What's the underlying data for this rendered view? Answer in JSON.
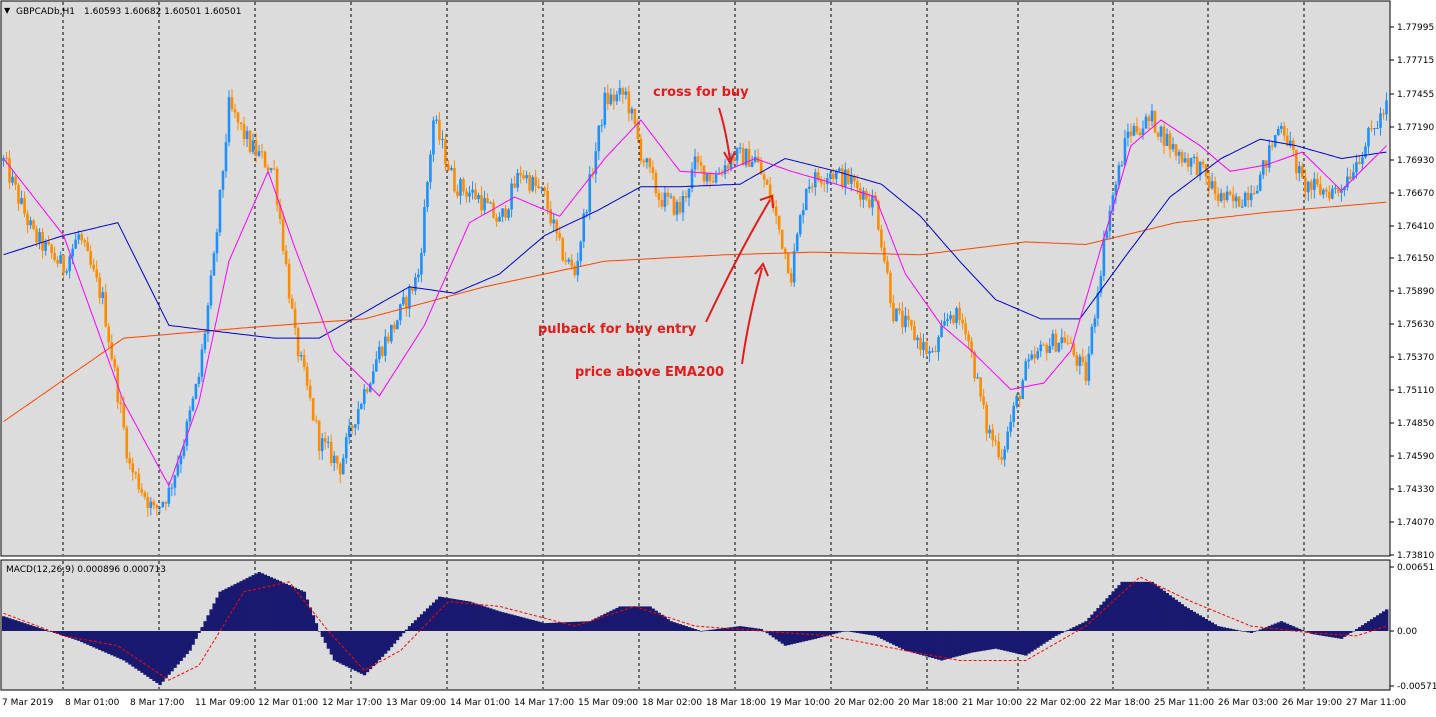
{
  "header": {
    "symbol": "GBPCADb,H1",
    "ohlc": "1.60593 1.60682 1.60501 1.60501",
    "macd_label": "MACD(12,26,9) 0.000896 0.000713"
  },
  "colors": {
    "background": "#dcdcdc",
    "bull_candle": "#1e90ff",
    "bear_candle": "#ff8c00",
    "ema_fast": "#ff00ff",
    "ema_mid": "#0000cd",
    "ema200": "#ff4500",
    "macd_hist": "#191970",
    "macd_signal": "#ff0000",
    "annotation": "#e31b1b"
  },
  "price_axis": [
    "1.77995",
    "1.77715",
    "1.77455",
    "1.77190",
    "1.76930",
    "1.76670",
    "1.76410",
    "1.76150",
    "1.75890",
    "1.75630",
    "1.75370",
    "1.75110",
    "1.74850",
    "1.74590",
    "1.74330",
    "1.74070",
    "1.73810"
  ],
  "macd_axis": [
    "0.00651",
    "0.00",
    "-0.005717"
  ],
  "time_axis": [
    "7 Mar 2019",
    "8 Mar 01:00",
    "8 Mar 17:00",
    "11 Mar 09:00",
    "12 Mar 01:00",
    "12 Mar 17:00",
    "13 Mar 09:00",
    "14 Mar 01:00",
    "14 Mar 17:00",
    "15 Mar 09:00",
    "18 Mar 02:00",
    "18 Mar 18:00",
    "19 Mar 10:00",
    "20 Mar 02:00",
    "20 Mar 18:00",
    "21 Mar 10:00",
    "22 Mar 02:00",
    "22 Mar 18:00",
    "25 Mar 11:00",
    "26 Mar 03:00",
    "26 Mar 19:00",
    "27 Mar 11:00"
  ],
  "annotations": {
    "cross": "cross for buy",
    "pullback": "pulback for buy entry",
    "ema200": "price above EMA200"
  },
  "chart_data": {
    "type": "candlestick",
    "symbol": "GBPCADb",
    "timeframe": "H1",
    "ylim": [
      1.7381,
      1.77995
    ],
    "anchors": [
      [
        0,
        1.7688
      ],
      [
        10,
        1.763
      ],
      [
        20,
        1.7605
      ],
      [
        25,
        1.763
      ],
      [
        33,
        1.758
      ],
      [
        42,
        1.745
      ],
      [
        50,
        1.7415
      ],
      [
        55,
        1.743
      ],
      [
        60,
        1.747
      ],
      [
        65,
        1.752
      ],
      [
        70,
        1.761
      ],
      [
        75,
        1.773
      ],
      [
        82,
        1.77
      ],
      [
        90,
        1.768
      ],
      [
        97,
        1.755
      ],
      [
        105,
        1.747
      ],
      [
        112,
        1.745
      ],
      [
        117,
        1.749
      ],
      [
        125,
        1.754
      ],
      [
        130,
        1.756
      ],
      [
        138,
        1.76
      ],
      [
        143,
        1.772
      ],
      [
        150,
        1.767
      ],
      [
        158,
        1.766
      ],
      [
        165,
        1.764
      ],
      [
        172,
        1.768
      ],
      [
        180,
        1.766
      ],
      [
        185,
        1.762
      ],
      [
        190,
        1.76
      ],
      [
        195,
        1.767
      ],
      [
        200,
        1.7735
      ],
      [
        207,
        1.774
      ],
      [
        212,
        1.7695
      ],
      [
        218,
        1.766
      ],
      [
        225,
        1.765
      ],
      [
        230,
        1.7685
      ],
      [
        236,
        1.7675
      ],
      [
        243,
        1.7692
      ],
      [
        250,
        1.769
      ],
      [
        255,
        1.766
      ],
      [
        262,
        1.76
      ],
      [
        267,
        1.767
      ],
      [
        275,
        1.768
      ],
      [
        282,
        1.7672
      ],
      [
        290,
        1.7655
      ],
      [
        296,
        1.757
      ],
      [
        302,
        1.7555
      ],
      [
        309,
        1.7535
      ],
      [
        315,
        1.757
      ],
      [
        320,
        1.756
      ],
      [
        327,
        1.748
      ],
      [
        332,
        1.746
      ],
      [
        340,
        1.7525
      ],
      [
        347,
        1.7545
      ],
      [
        353,
        1.755
      ],
      [
        360,
        1.752
      ],
      [
        367,
        1.764
      ],
      [
        374,
        1.771
      ],
      [
        382,
        1.772
      ],
      [
        390,
        1.7695
      ],
      [
        397,
        1.7685
      ],
      [
        404,
        1.766
      ],
      [
        410,
        1.7655
      ],
      [
        418,
        1.7675
      ],
      [
        425,
        1.772
      ],
      [
        432,
        1.767
      ],
      [
        438,
        1.7665
      ],
      [
        444,
        1.7665
      ],
      [
        448,
        1.768
      ],
      [
        455,
        1.771
      ],
      [
        460,
        1.773
      ]
    ],
    "ema_fast": [
      [
        0,
        1.769
      ],
      [
        20,
        1.763
      ],
      [
        40,
        1.75
      ],
      [
        55,
        1.7435
      ],
      [
        65,
        1.75
      ],
      [
        75,
        1.761
      ],
      [
        88,
        1.768
      ],
      [
        97,
        1.762
      ],
      [
        110,
        1.754
      ],
      [
        125,
        1.7505
      ],
      [
        140,
        1.756
      ],
      [
        155,
        1.764
      ],
      [
        170,
        1.766
      ],
      [
        185,
        1.7645
      ],
      [
        200,
        1.769
      ],
      [
        212,
        1.772
      ],
      [
        225,
        1.768
      ],
      [
        238,
        1.7678
      ],
      [
        250,
        1.769
      ],
      [
        262,
        1.768
      ],
      [
        277,
        1.767
      ],
      [
        290,
        1.766
      ],
      [
        300,
        1.76
      ],
      [
        312,
        1.756
      ],
      [
        322,
        1.754
      ],
      [
        335,
        1.751
      ],
      [
        346,
        1.7515
      ],
      [
        355,
        1.754
      ],
      [
        365,
        1.762
      ],
      [
        375,
        1.77
      ],
      [
        385,
        1.772
      ],
      [
        398,
        1.77
      ],
      [
        408,
        1.768
      ],
      [
        420,
        1.7685
      ],
      [
        432,
        1.7695
      ],
      [
        445,
        1.7665
      ],
      [
        460,
        1.77
      ]
    ],
    "ema_mid": [
      [
        0,
        1.7615
      ],
      [
        20,
        1.763
      ],
      [
        38,
        1.764
      ],
      [
        55,
        1.756
      ],
      [
        72,
        1.7555
      ],
      [
        90,
        1.755
      ],
      [
        105,
        1.755
      ],
      [
        120,
        1.757
      ],
      [
        135,
        1.759
      ],
      [
        150,
        1.7585
      ],
      [
        165,
        1.76
      ],
      [
        180,
        1.763
      ],
      [
        198,
        1.765
      ],
      [
        212,
        1.7668
      ],
      [
        225,
        1.7668
      ],
      [
        245,
        1.767
      ],
      [
        260,
        1.769
      ],
      [
        277,
        1.768
      ],
      [
        292,
        1.767
      ],
      [
        305,
        1.7645
      ],
      [
        318,
        1.761
      ],
      [
        330,
        1.758
      ],
      [
        345,
        1.7565
      ],
      [
        358,
        1.7565
      ],
      [
        372,
        1.761
      ],
      [
        388,
        1.766
      ],
      [
        405,
        1.769
      ],
      [
        418,
        1.7705
      ],
      [
        430,
        1.77
      ],
      [
        445,
        1.769
      ],
      [
        460,
        1.7695
      ]
    ],
    "ema200": [
      [
        0,
        1.7485
      ],
      [
        40,
        1.755
      ],
      [
        80,
        1.7558
      ],
      [
        120,
        1.7565
      ],
      [
        160,
        1.759
      ],
      [
        200,
        1.761
      ],
      [
        240,
        1.7615
      ],
      [
        270,
        1.7617
      ],
      [
        305,
        1.7615
      ],
      [
        340,
        1.7625
      ],
      [
        360,
        1.7623
      ],
      [
        390,
        1.764
      ],
      [
        420,
        1.7648
      ],
      [
        460,
        1.7656
      ]
    ],
    "macd_hist": [
      [
        0,
        0.0015
      ],
      [
        15,
        0.0
      ],
      [
        25,
        -0.001
      ],
      [
        40,
        -0.003
      ],
      [
        52,
        -0.0055
      ],
      [
        62,
        -0.002
      ],
      [
        72,
        0.004
      ],
      [
        85,
        0.006
      ],
      [
        100,
        0.004
      ],
      [
        105,
        0.0
      ],
      [
        110,
        -0.003
      ],
      [
        120,
        -0.0045
      ],
      [
        128,
        -0.002
      ],
      [
        135,
        0.0005
      ],
      [
        145,
        0.0035
      ],
      [
        155,
        0.003
      ],
      [
        165,
        0.002
      ],
      [
        180,
        0.0008
      ],
      [
        195,
        0.001
      ],
      [
        205,
        0.0025
      ],
      [
        215,
        0.0025
      ],
      [
        222,
        0.001
      ],
      [
        232,
        0.0
      ],
      [
        245,
        0.0005
      ],
      [
        252,
        0.0002
      ],
      [
        260,
        -0.0015
      ],
      [
        270,
        -0.0008
      ],
      [
        280,
        0.0
      ],
      [
        290,
        -0.0005
      ],
      [
        300,
        -0.002
      ],
      [
        312,
        -0.003
      ],
      [
        322,
        -0.0022
      ],
      [
        330,
        -0.0018
      ],
      [
        340,
        -0.0025
      ],
      [
        350,
        -0.0005
      ],
      [
        360,
        0.001
      ],
      [
        372,
        0.005
      ],
      [
        382,
        0.005
      ],
      [
        393,
        0.0025
      ],
      [
        404,
        0.0005
      ],
      [
        415,
        -0.0002
      ],
      [
        425,
        0.001
      ],
      [
        435,
        -0.0003
      ],
      [
        445,
        -0.0008
      ],
      [
        455,
        0.0012
      ],
      [
        460,
        0.0022
      ]
    ],
    "macd_signal": [
      [
        0,
        0.0018
      ],
      [
        20,
        -0.0005
      ],
      [
        38,
        -0.0015
      ],
      [
        55,
        -0.005
      ],
      [
        65,
        -0.0035
      ],
      [
        80,
        0.004
      ],
      [
        95,
        0.005
      ],
      [
        108,
        0.0
      ],
      [
        120,
        -0.004
      ],
      [
        132,
        -0.002
      ],
      [
        148,
        0.003
      ],
      [
        165,
        0.0025
      ],
      [
        190,
        0.0005
      ],
      [
        210,
        0.0025
      ],
      [
        230,
        0.0005
      ],
      [
        252,
        0.0
      ],
      [
        275,
        -0.0005
      ],
      [
        300,
        -0.002
      ],
      [
        318,
        -0.003
      ],
      [
        340,
        -0.003
      ],
      [
        360,
        0.0005
      ],
      [
        378,
        0.0055
      ],
      [
        395,
        0.003
      ],
      [
        415,
        0.0005
      ],
      [
        435,
        -0.0002
      ],
      [
        450,
        -0.0005
      ],
      [
        460,
        0.0005
      ]
    ]
  }
}
